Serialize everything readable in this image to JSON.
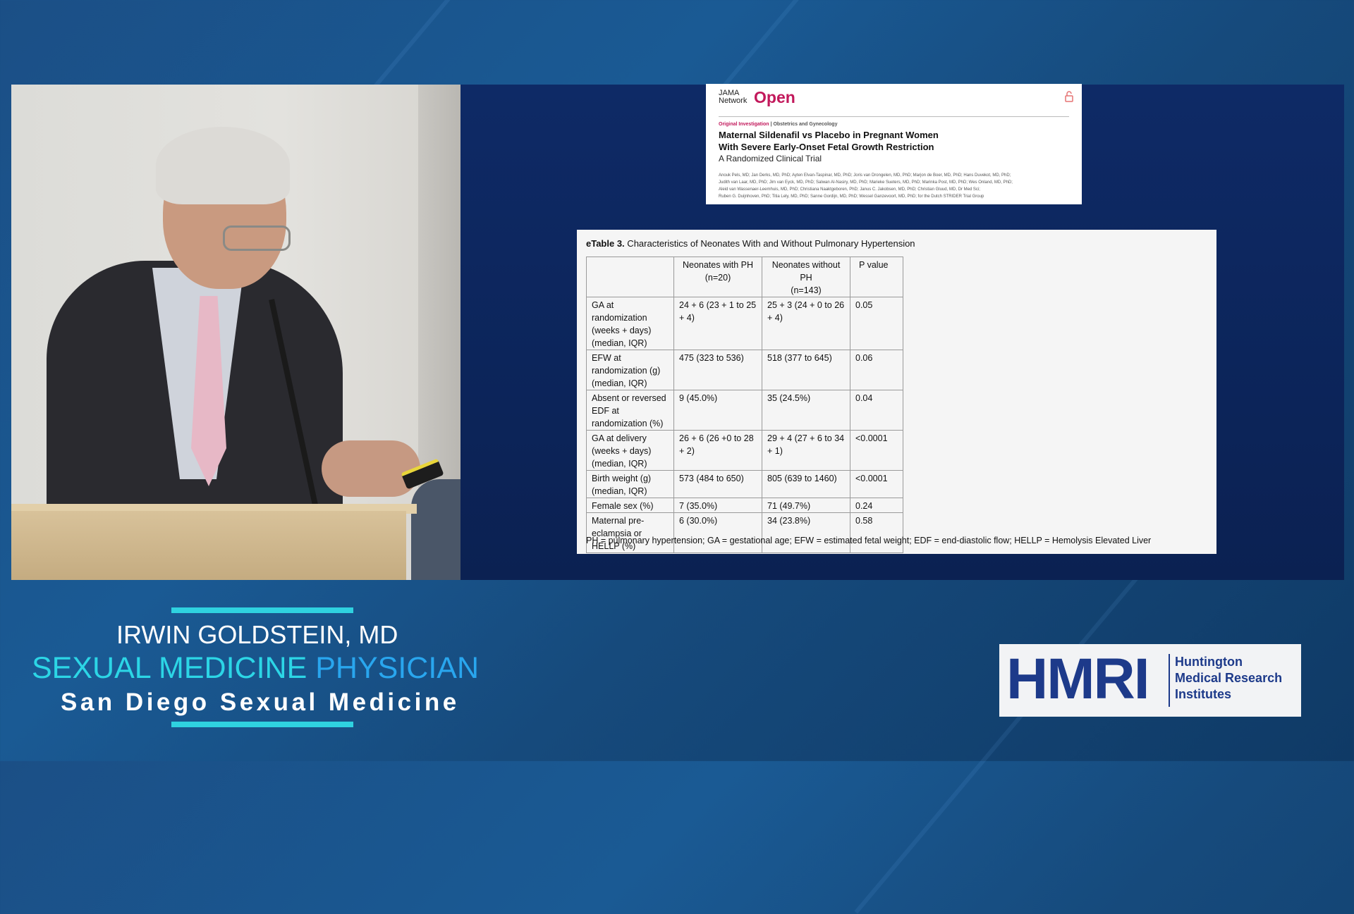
{
  "article": {
    "journal_small": "JAMA\nNetwork",
    "journal_open": "Open",
    "category_type": "Original Investigation",
    "category_field": "Obstetrics and Gynecology",
    "title_line1": "Maternal Sildenafil vs Placebo in Pregnant Women",
    "title_line2": "With Severe Early-Onset Fetal Growth Restriction",
    "subtitle": "A Randomized Clinical Trial",
    "authors_line1": "Anouk Pels, MD; Jan Derks, MD, PhD; Ayten Elvan-Taspinar, MD, PhD; Joris van Drongelen, MD, PhD; Marjon de Boer, MD, PhD; Hans Duvekot, MD, PhD;",
    "authors_line2": "Judith van Laar, MD, PhD; Jim van Eyck, MD, PhD; Salwan Al-Nasiry, MD, PhD; Marieke Sueters, MD, PhD; Marinka Post, MD, PhD; Wes Onland, MD, PhD;",
    "authors_line3": "Aleid van Wassenaer-Leemhuis, MD, PhD; Christiana Naaktgeboren, PhD; Janus C. Jakobsen, MD, PhD; Christian Gluud, MD, Dr Med Sci;",
    "authors_line4": "Ruben G. Duijnhoven, PhD; Titia Lely, MD, PhD; Sanne Gordijn, MD, PhD; Wessel Ganzevoort, MD, PhD; for the Dutch STRIDER Trial Group"
  },
  "etable": {
    "title_bold": "eTable 3.",
    "title_rest": " Characteristics of Neonates With and Without Pulmonary Hypertension",
    "headers": [
      "",
      "Neonates with PH\n(n=20)",
      "Neonates without\nPH\n(n=143)",
      "P value"
    ],
    "rows": [
      [
        "GA at randomization (weeks + days) (median, IQR)",
        "24 + 6 (23 + 1 to 25 + 4)",
        "25 + 3 (24 + 0 to 26 + 4)",
        "0.05"
      ],
      [
        "EFW at randomization (g) (median, IQR)",
        "475 (323 to 536)",
        "518 (377 to 645)",
        "0.06"
      ],
      [
        "Absent or reversed EDF at randomization (%)",
        "9 (45.0%)",
        "35 (24.5%)",
        "0.04"
      ],
      [
        "GA at delivery (weeks + days) (median, IQR)",
        "26 + 6 (26 +0 to 28 + 2)",
        "29 + 4 (27 + 6 to 34 + 1)",
        "<0.0001"
      ],
      [
        "Birth weight (g) (median, IQR)",
        "573 (484 to 650)",
        "805 (639 to 1460)",
        "<0.0001"
      ],
      [
        "Female sex (%)",
        "7 (35.0%)",
        "71 (49.7%)",
        "0.24"
      ],
      [
        "Maternal pre-eclampsia or HELLP (%)",
        "6 (30.0%)",
        "34 (23.8%)",
        "0.58"
      ]
    ],
    "footnote": "PH = pulmonary hypertension; GA = gestational age; EFW = estimated fetal weight; EDF = end-diastolic flow; HELLP = Hemolysis Elevated Liver"
  },
  "speaker": {
    "name": "IRWIN GOLDSTEIN, MD",
    "role_part1": "SEXUAL MEDICINE ",
    "role_part2": "PHYSICIAN",
    "org": "San Diego Sexual Medicine"
  },
  "logo": {
    "mark": "HMRI",
    "line1": "Huntington",
    "line2": "Medical Research",
    "line3": "Institutes"
  },
  "colors": {
    "accent_cyan": "#2fd2e0",
    "role_blue": "#29a6ee",
    "jama_red": "#c2185b",
    "hmri_blue": "#1d3a8a"
  }
}
